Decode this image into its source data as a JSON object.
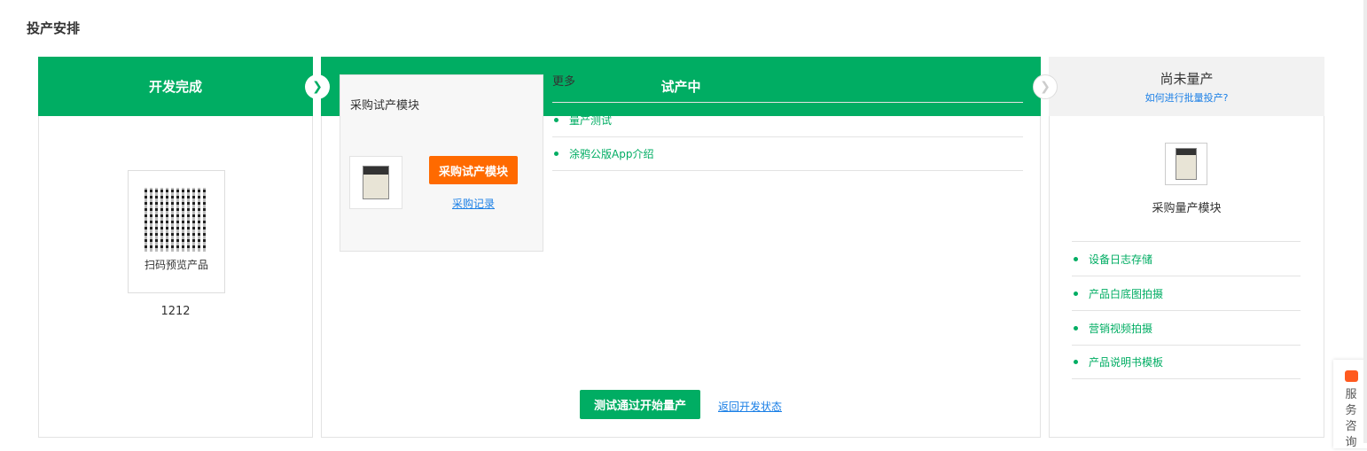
{
  "page": {
    "title": "投产安排"
  },
  "steps": [
    {
      "label": "开发完成",
      "qr_label": "扫码预览产品",
      "product_id": "1212"
    },
    {
      "label": "试产中",
      "buy_box": {
        "title": "采购试产模块",
        "buy_button": "采购试产模块",
        "record_link": "采购记录"
      },
      "more": {
        "title": "更多",
        "items": [
          "量产测试",
          "涂鸦公版App介绍"
        ]
      },
      "pass_button": "测试通过开始量产",
      "back_link": "返回开发状态"
    },
    {
      "label": "尚未量产",
      "help_link": "如何进行批量投产?",
      "module_label": "采购量产模块",
      "items": [
        "设备日志存储",
        "产品白底图拍摄",
        "营销视频拍摄",
        "产品说明书模板"
      ]
    }
  ],
  "service": {
    "label": "服务咨询"
  },
  "colors": {
    "green": "#00ad63",
    "orange": "#ff6a00",
    "link": "#1a7fe6"
  }
}
